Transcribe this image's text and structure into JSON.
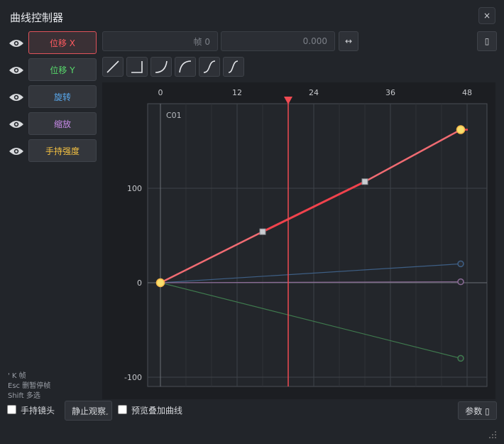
{
  "window": {
    "title": "曲线控制器",
    "close_label": "×"
  },
  "tracks": [
    {
      "label": "位移 X",
      "color": "#ff5a5f",
      "active": true
    },
    {
      "label": "位移 Y",
      "color": "#57d96b",
      "active": false
    },
    {
      "label": "旋转",
      "color": "#5aaaf0",
      "active": false
    },
    {
      "label": "缩放",
      "color": "#c78ae8",
      "active": false
    },
    {
      "label": "手持强度",
      "color": "#f5c242",
      "active": false
    }
  ],
  "toolbar": {
    "frame_placeholder": "帧 0",
    "value_placeholder": "0.000",
    "swap_label": "↔",
    "right_icon_label": "▯"
  },
  "easing_buttons": [
    "linear",
    "step",
    "ease-in",
    "ease-out",
    "ease-in-out",
    "s-curve"
  ],
  "chart_data": {
    "type": "line",
    "x_ticks": [
      0,
      12,
      24,
      36,
      48
    ],
    "y_ticks": [
      100,
      0,
      -100
    ],
    "xlim": [
      0,
      48
    ],
    "ylim": [
      -100,
      200
    ],
    "playhead_frame": 20,
    "channel_label": "C01",
    "grid": true,
    "series": [
      {
        "key": "pos_x",
        "color": "#f06b72",
        "points": [
          [
            0,
            0
          ],
          [
            16,
            54
          ],
          [
            32,
            107
          ],
          [
            47,
            162
          ]
        ],
        "keyframes": [
          0,
          47
        ],
        "handles": [
          16,
          32
        ]
      },
      {
        "key": "pos_y",
        "color": "#3f7a4e",
        "points": [
          [
            0,
            0
          ],
          [
            47,
            -80
          ]
        ],
        "end_marker": true
      },
      {
        "key": "rotation",
        "color": "#3e5f85",
        "points": [
          [
            0,
            0
          ],
          [
            47,
            20
          ]
        ],
        "end_marker": true
      },
      {
        "key": "scale",
        "color": "#8a6a95",
        "points": [
          [
            0,
            0
          ],
          [
            47,
            1
          ]
        ],
        "end_marker": true
      }
    ]
  },
  "hints": [
    "' K 帧",
    "Esc 删暂停帧",
    "Shift 多选"
  ],
  "bottom": {
    "handheld_label": "手持镜头",
    "mode_value": "静止观察",
    "preview_label": "预览叠加曲线",
    "params_label": "参数 ▯"
  }
}
